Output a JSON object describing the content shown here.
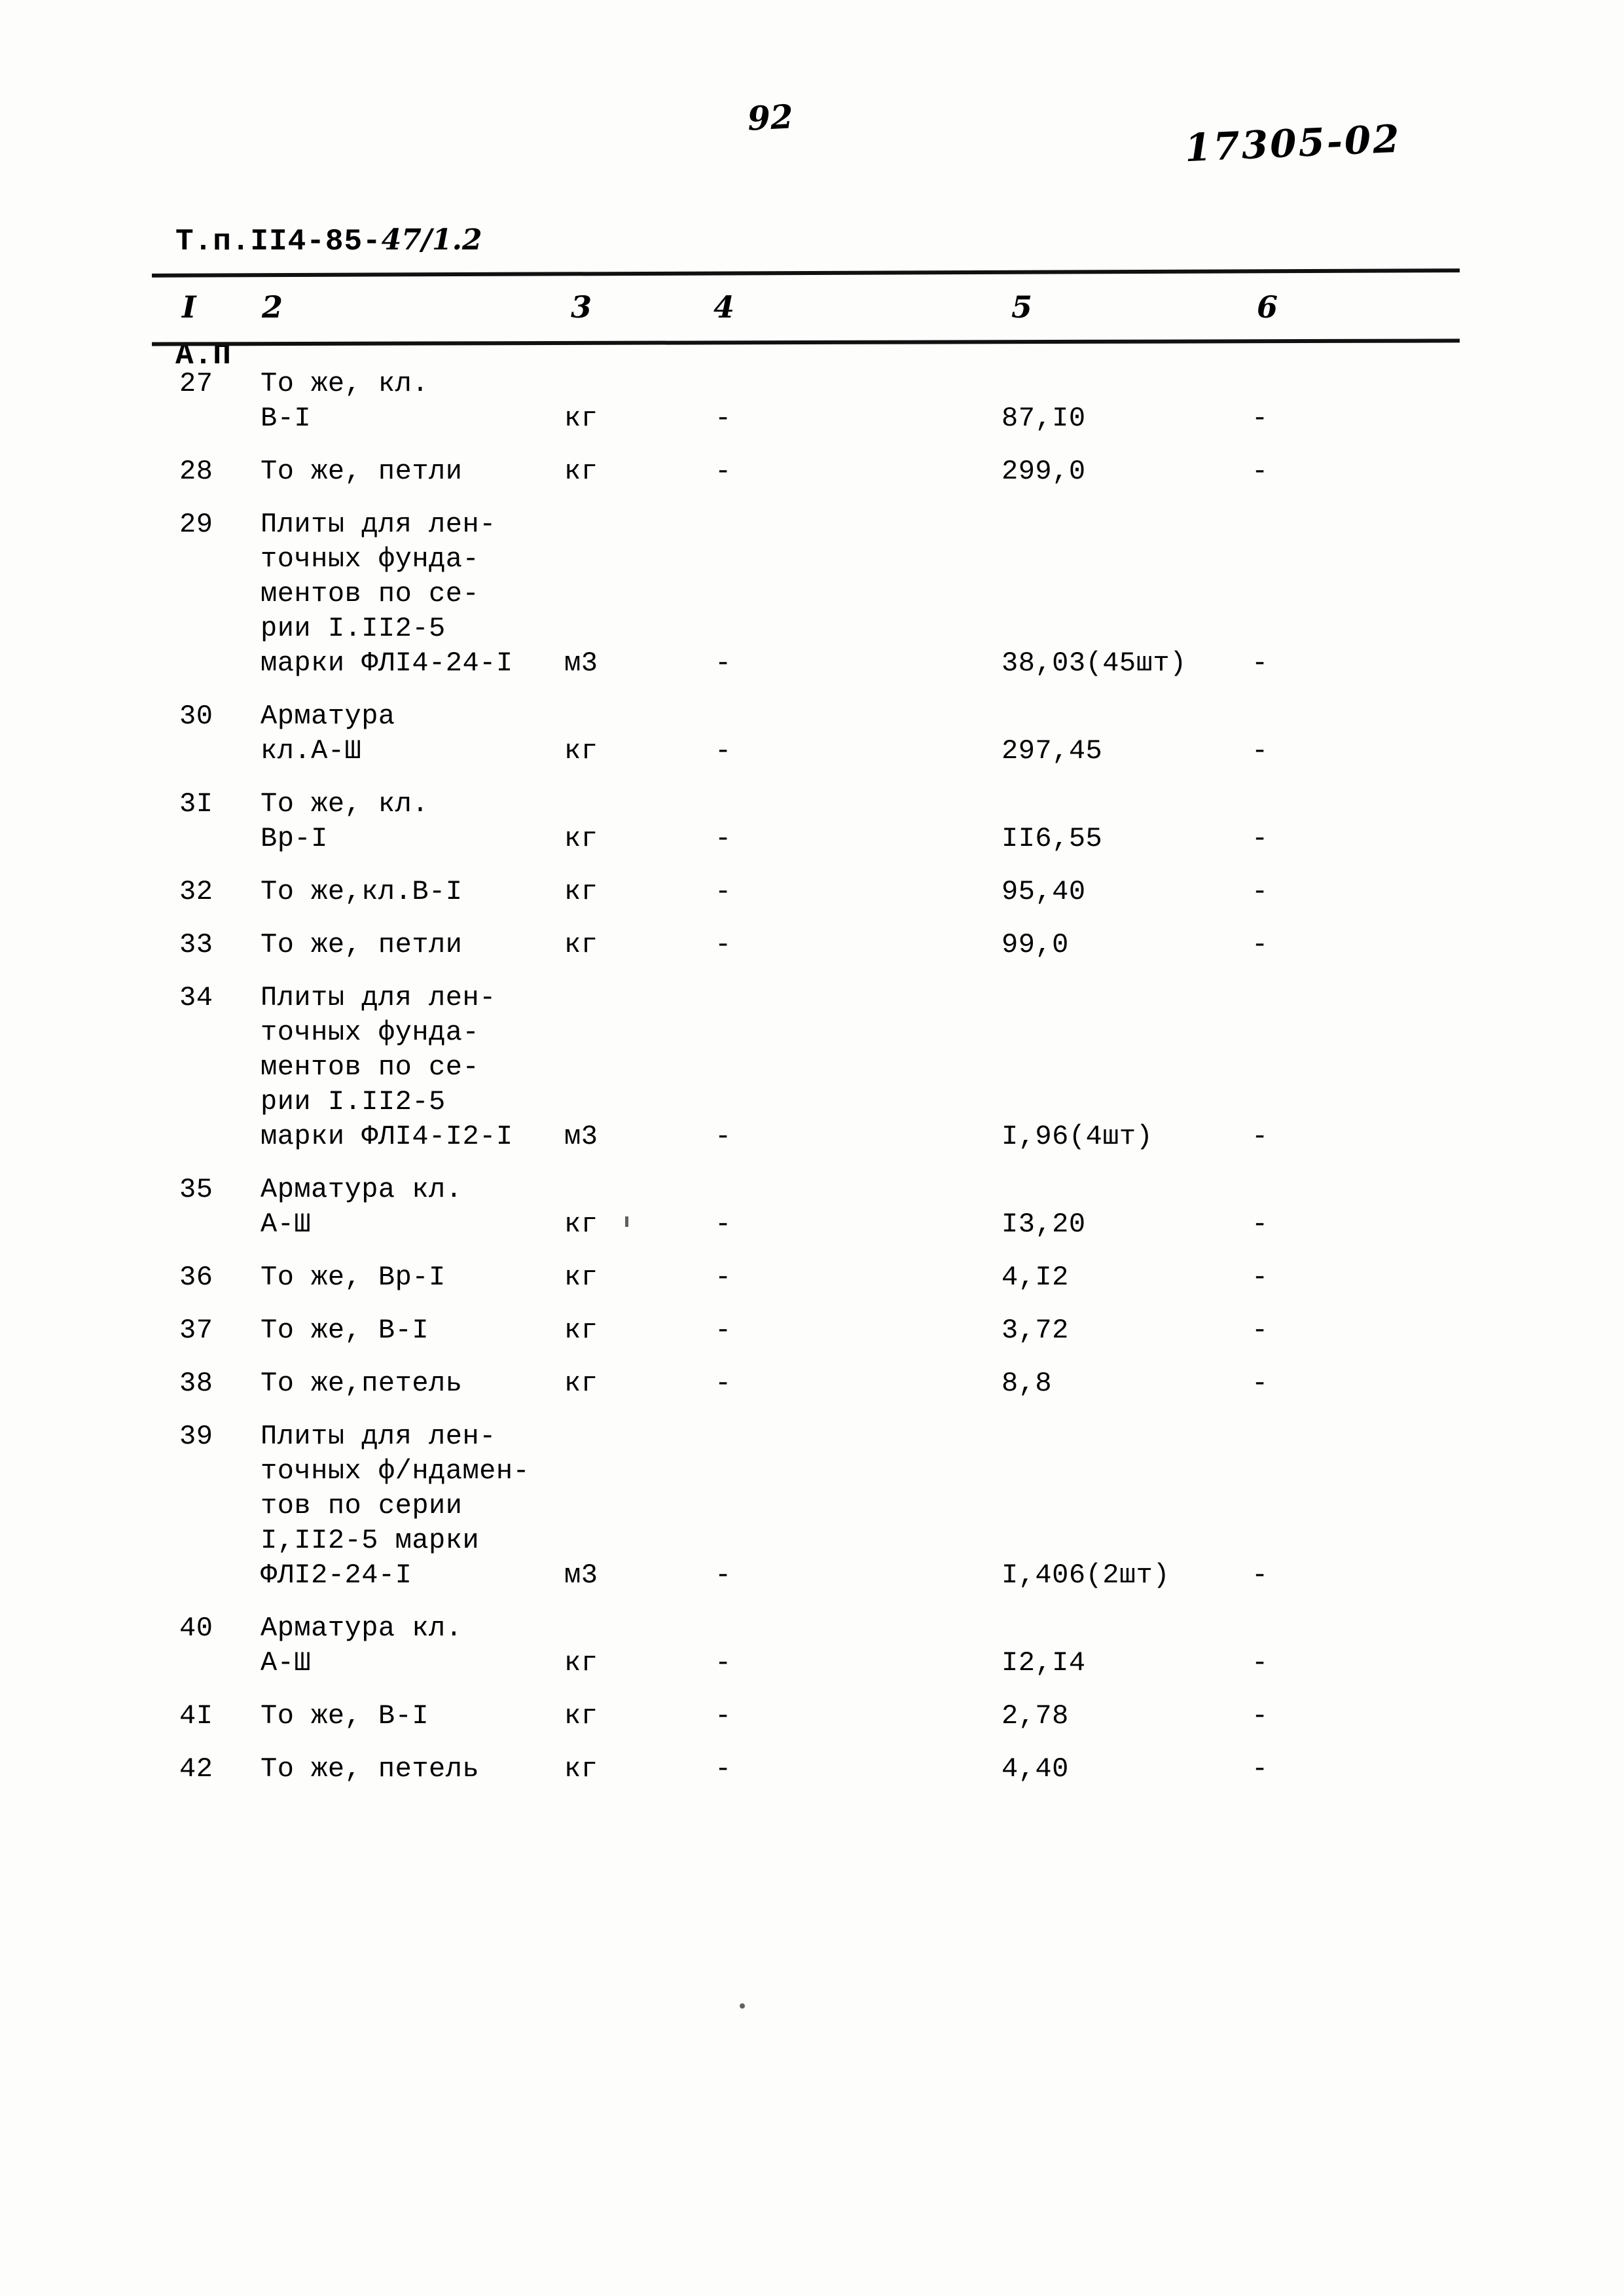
{
  "header": {
    "doc_code": "Т.п.II4-85-",
    "doc_code_hand": "47/1.2",
    "doc_sub": "А.П",
    "page_number": "92",
    "archive_code": "17305-02"
  },
  "table": {
    "column_headers": [
      "I",
      "2",
      "3",
      "4",
      "5",
      "6"
    ],
    "rows": [
      {
        "num": "27",
        "desc": [
          "То же, кл.",
          "В-I"
        ],
        "unit": "кг",
        "col4": "-",
        "value": "87,I0",
        "col6": "-"
      },
      {
        "num": "28",
        "desc": [
          "То же, петли"
        ],
        "unit": "кг",
        "col4": "-",
        "value": "299,0",
        "col6": "-"
      },
      {
        "num": "29",
        "desc": [
          "Плиты для лен-",
          "точных фунда-",
          "ментов по се-",
          "рии I.II2-5",
          "марки ФЛI4-24-I"
        ],
        "unit": "м3",
        "col4": "-",
        "value": "38,03(45шт)",
        "col6": "-"
      },
      {
        "num": "30",
        "desc": [
          "Арматура",
          "кл.А-Ш"
        ],
        "unit": "кг",
        "col4": "-",
        "value": "297,45",
        "col6": "-"
      },
      {
        "num": "3I",
        "desc": [
          "То же, кл.",
          "Вр-I"
        ],
        "unit": "кг",
        "col4": "-",
        "value": "II6,55",
        "col6": "-"
      },
      {
        "num": "32",
        "desc": [
          "То же,кл.В-I"
        ],
        "unit": "кг",
        "col4": "-",
        "value": "95,40",
        "col6": "-"
      },
      {
        "num": "33",
        "desc": [
          "То же, петли"
        ],
        "unit": "кг",
        "col4": "-",
        "value": "99,0",
        "col6": "-"
      },
      {
        "num": "34",
        "desc": [
          "Плиты для лен-",
          "точных фунда-",
          "ментов по се-",
          "рии I.II2-5",
          "марки ФЛI4-I2-I"
        ],
        "unit": "м3",
        "col4": "-",
        "value": "I,96(4шт)",
        "col6": "-"
      },
      {
        "num": "35",
        "desc": [
          "Арматура кл.",
          "А-Ш"
        ],
        "unit": "кг",
        "col4": "-",
        "value": "I3,20",
        "col6": "-"
      },
      {
        "num": "36",
        "desc": [
          "То же, Вр-I"
        ],
        "unit": "кг",
        "col4": "-",
        "value": "4,I2",
        "col6": "-"
      },
      {
        "num": "37",
        "desc": [
          "То же, В-I"
        ],
        "unit": "кг",
        "col4": "-",
        "value": "3,72",
        "col6": "-"
      },
      {
        "num": "38",
        "desc": [
          "То же,петель"
        ],
        "unit": "кг",
        "col4": "-",
        "value": "8,8",
        "col6": "-"
      },
      {
        "num": "39",
        "desc": [
          "Плиты для лен-",
          "точных ф/ндамен-",
          "тов по серии",
          "I,II2-5 марки",
          "ФЛI2-24-I"
        ],
        "unit": "м3",
        "col4": "-",
        "value": "I,406(2шт)",
        "col6": "-"
      },
      {
        "num": "40",
        "desc": [
          "Арматура кл.",
          "А-Ш"
        ],
        "unit": "кг",
        "col4": "-",
        "value": "I2,I4",
        "col6": "-"
      },
      {
        "num": "4I",
        "desc": [
          "То же, В-I"
        ],
        "unit": "кг",
        "col4": "-",
        "value": "2,78",
        "col6": "-"
      },
      {
        "num": "42",
        "desc": [
          "То же, петель"
        ],
        "unit": "кг",
        "col4": "-",
        "value": "4,40",
        "col6": "-"
      }
    ]
  }
}
